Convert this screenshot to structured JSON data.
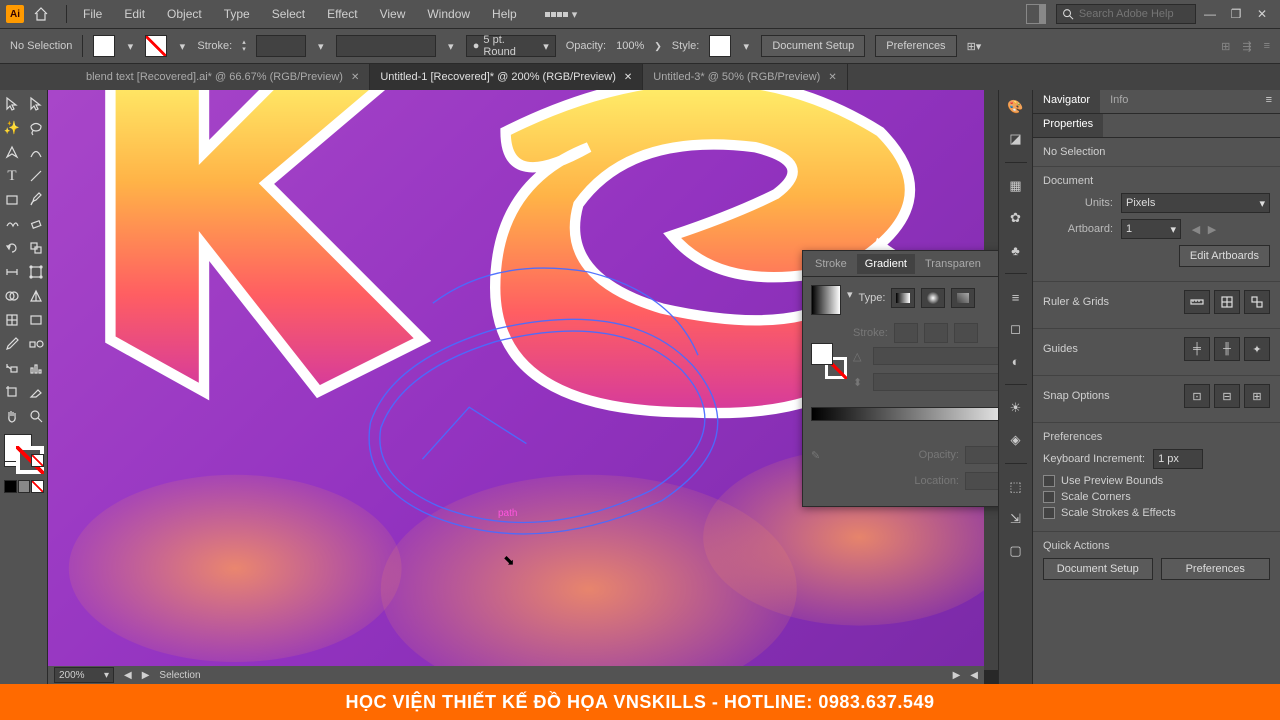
{
  "menu": {
    "items": [
      "File",
      "Edit",
      "Object",
      "Type",
      "Select",
      "Effect",
      "View",
      "Window",
      "Help"
    ]
  },
  "search": {
    "placeholder": "Search Adobe Help"
  },
  "controlbar": {
    "selection_label": "No Selection",
    "stroke_label": "Stroke:",
    "stroke_bullet": "●",
    "stroke_weight": "5 pt. Round",
    "opacity_label": "Opacity:",
    "opacity_value": "100%",
    "style_label": "Style:",
    "doc_setup": "Document Setup",
    "preferences": "Preferences"
  },
  "tabs": [
    {
      "label": "blend text [Recovered].ai* @ 66.67% (RGB/Preview)",
      "active": false
    },
    {
      "label": "Untitled-1 [Recovered]* @ 200% (RGB/Preview)",
      "active": true
    },
    {
      "label": "Untitled-3* @ 50% (RGB/Preview)",
      "active": false
    }
  ],
  "canvas": {
    "path_label": "path",
    "zoom": "200%",
    "status": "Selection"
  },
  "gradient_panel": {
    "tabs": [
      "Stroke",
      "Gradient",
      "Transparen"
    ],
    "active_tab": 1,
    "type_label": "Type:",
    "stroke_label": "Stroke:",
    "opacity_label": "Opacity:",
    "location_label": "Location:"
  },
  "right_panel": {
    "top_tabs": [
      "Navigator",
      "Info"
    ],
    "properties_tab": "Properties",
    "no_selection": "No Selection",
    "document_heading": "Document",
    "units_label": "Units:",
    "units_value": "Pixels",
    "artboard_label": "Artboard:",
    "artboard_value": "1",
    "edit_artboards": "Edit Artboards",
    "ruler_grids": "Ruler & Grids",
    "guides": "Guides",
    "snap_options": "Snap Options",
    "preferences_heading": "Preferences",
    "kb_increment_label": "Keyboard Increment:",
    "kb_increment_value": "1 px",
    "use_preview_bounds": "Use Preview Bounds",
    "scale_corners": "Scale Corners",
    "scale_strokes": "Scale Strokes & Effects",
    "quick_actions": "Quick Actions",
    "qa_doc_setup": "Document Setup",
    "qa_preferences": "Preferences"
  },
  "banner": "HỌC VIỆN THIẾT KẾ ĐỒ HỌA VNSKILLS - HOTLINE: 0983.637.549"
}
